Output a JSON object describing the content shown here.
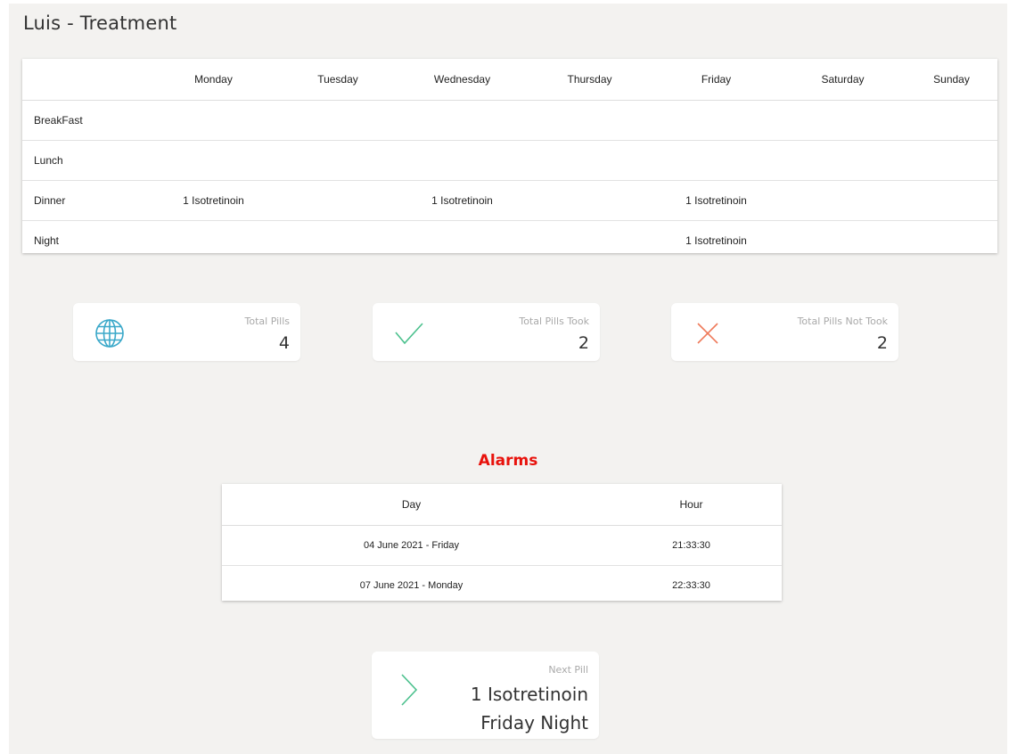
{
  "page": {
    "title": "Luis - Treatment"
  },
  "schedule": {
    "days": [
      "Monday",
      "Tuesday",
      "Wednesday",
      "Thursday",
      "Friday",
      "Saturday",
      "Sunday"
    ],
    "rows": [
      {
        "label": "BreakFast",
        "cells": [
          "",
          "",
          "",
          "",
          "",
          "",
          ""
        ]
      },
      {
        "label": "Lunch",
        "cells": [
          "",
          "",
          "",
          "",
          "",
          "",
          ""
        ]
      },
      {
        "label": "Dinner",
        "cells": [
          "1 Isotretinoin",
          "",
          "1 Isotretinoin",
          "",
          "1 Isotretinoin",
          "",
          ""
        ]
      },
      {
        "label": "Night",
        "cells": [
          "",
          "",
          "",
          "",
          "1 Isotretinoin",
          "",
          ""
        ]
      }
    ]
  },
  "stats": {
    "total": {
      "label": "Total Pills",
      "value": "4",
      "icon": "globe-icon",
      "color": "#3aa8c9"
    },
    "took": {
      "label": "Total Pills Took",
      "value": "2",
      "icon": "check-icon",
      "color": "#4cc18e"
    },
    "not_took": {
      "label": "Total Pills Not Took",
      "value": "2",
      "icon": "x-icon",
      "color": "#ef7a5a"
    }
  },
  "alarms": {
    "title": "Alarms",
    "title_color": "#e8120c",
    "headers": {
      "day": "Day",
      "hour": "Hour"
    },
    "rows": [
      {
        "day": "04 June 2021 - Friday",
        "hour": "21:33:30"
      },
      {
        "day": "07 June 2021 - Monday",
        "hour": "22:33:30"
      }
    ]
  },
  "next_pill": {
    "label": "Next Pill",
    "medication": "1 Isotretinoin",
    "when": "Friday Night",
    "icon": "chevron-right-icon",
    "color": "#4cc18e"
  }
}
